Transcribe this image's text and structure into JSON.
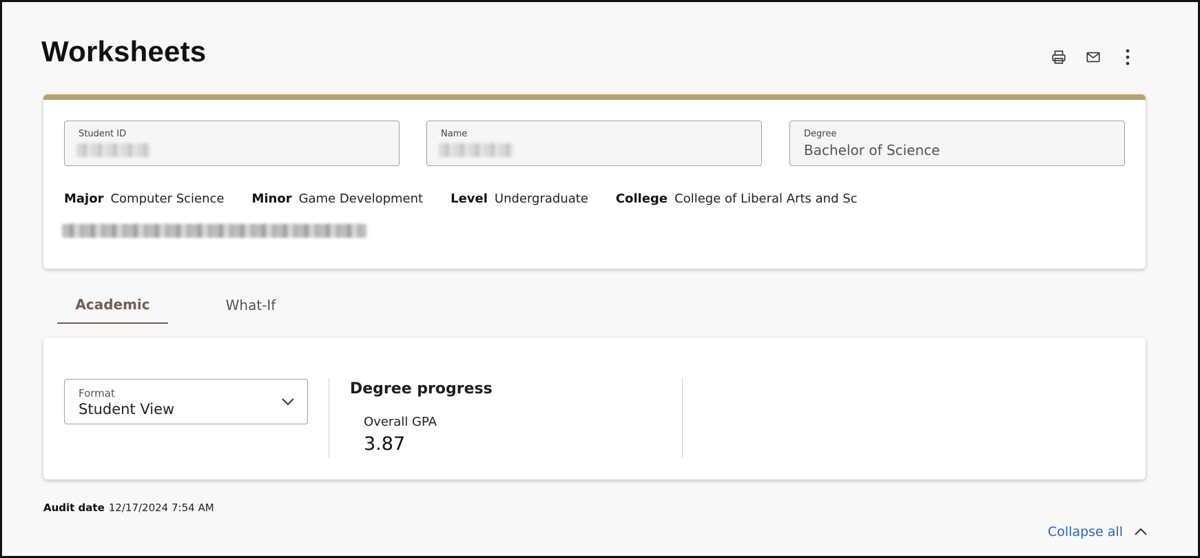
{
  "page": {
    "title": "Worksheets"
  },
  "toolbar": {
    "print_icon": "printer-icon",
    "email_icon": "mail-icon",
    "more_icon": "more-vertical-icon"
  },
  "student": {
    "id_label": "Student ID",
    "name_label": "Name",
    "degree_label": "Degree",
    "degree_value": "Bachelor of Science",
    "major_label": "Major",
    "major_value": "Computer Science",
    "minor_label": "Minor",
    "minor_value": "Game Development",
    "level_label": "Level",
    "level_value": "Undergraduate",
    "college_label": "College",
    "college_value": "College of Liberal Arts and Sc"
  },
  "tabs": [
    {
      "label": "Academic",
      "active": true
    },
    {
      "label": "What-If",
      "active": false
    }
  ],
  "format": {
    "label": "Format",
    "value": "Student View"
  },
  "progress": {
    "title": "Degree progress",
    "gpa_label": "Overall  GPA",
    "gpa_value": "3.87"
  },
  "audit": {
    "label": "Audit date",
    "value": "12/17/2024 7:54 AM"
  },
  "collapse": {
    "label": "Collapse all"
  },
  "colors": {
    "accent_bar": "#b4a270",
    "tab_active": "#6e6155",
    "link": "#2a63c0"
  }
}
